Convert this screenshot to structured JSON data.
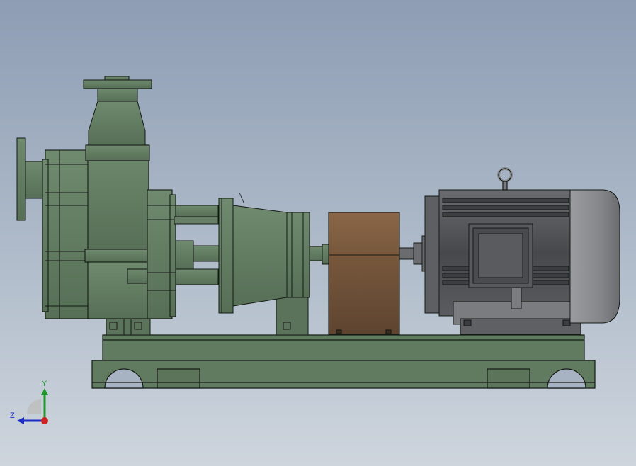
{
  "viewport": {
    "background_top": "#8e9db4",
    "background_bottom": "#ced5dd"
  },
  "model": {
    "pump_color": "#5e7a5e",
    "coupling_guard_color": "#7c5c43",
    "motor_color": "#4d4f52",
    "motor_endcap_color": "#8a8c8f",
    "edge_color": "#151a15"
  },
  "triad": {
    "y_label": "Y",
    "z_label": "Z",
    "y_axis_color": "#1f9a2a",
    "z_axis_color": "#1c2bc8",
    "origin_color": "#cc2222"
  }
}
